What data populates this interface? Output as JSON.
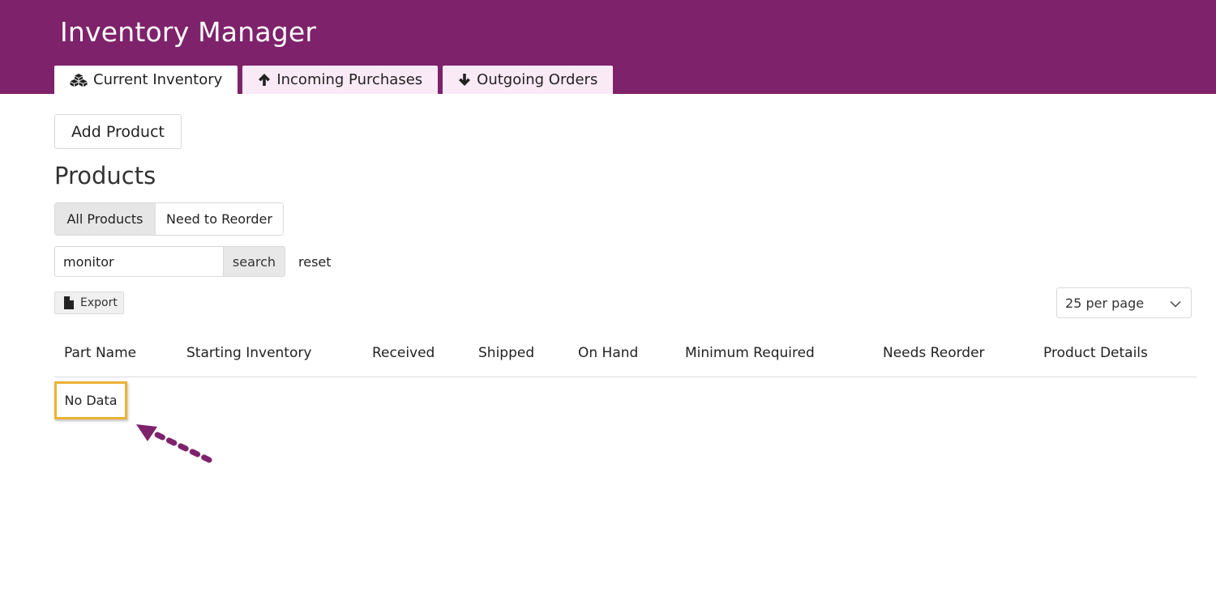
{
  "app": {
    "title": "Inventory Manager"
  },
  "tabs": [
    {
      "label": "Current Inventory",
      "icon": "cubes-icon",
      "active": true
    },
    {
      "label": "Incoming Purchases",
      "icon": "arrow-up-icon",
      "active": false
    },
    {
      "label": "Outgoing Orders",
      "icon": "arrow-down-icon",
      "active": false
    }
  ],
  "toolbar": {
    "add_product_label": "Add Product"
  },
  "products": {
    "title": "Products",
    "filters": [
      {
        "label": "All Products",
        "active": true
      },
      {
        "label": "Need to Reorder",
        "active": false
      }
    ],
    "search": {
      "value": "monitor",
      "button_label": "search",
      "reset_label": "reset"
    },
    "export_label": "Export",
    "per_page": {
      "selected": "25 per page"
    },
    "columns": [
      "Part Name",
      "Starting Inventory",
      "Received",
      "Shipped",
      "On Hand",
      "Minimum Required",
      "Needs Reorder",
      "Product Details"
    ],
    "empty_text": "No Data"
  },
  "colors": {
    "brand": "#7e226b",
    "tab_inactive": "#f9eaf5",
    "highlight": "#eab334",
    "annotation_arrow": "#7e226b"
  }
}
